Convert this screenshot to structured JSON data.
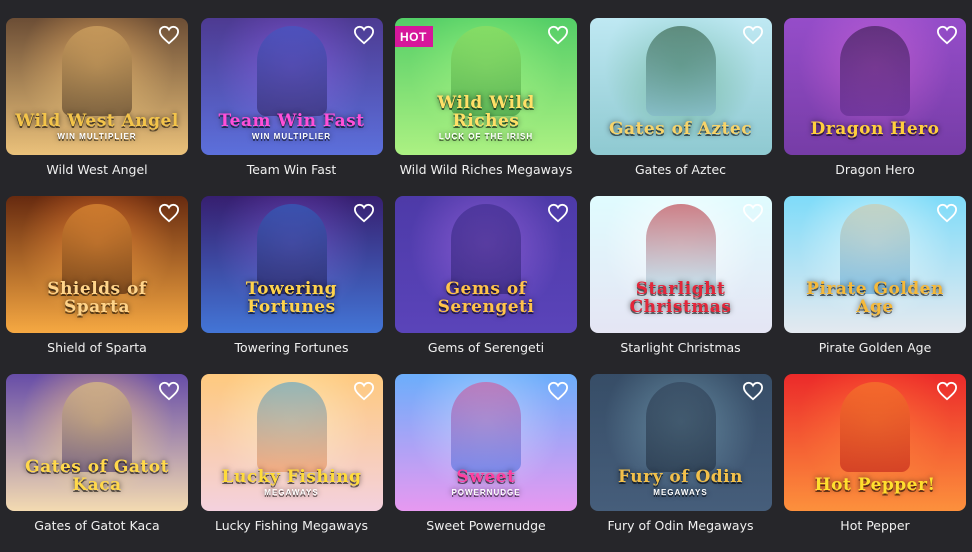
{
  "games": [
    {
      "title": "Wild West Angel",
      "logo": "Wild West Angel",
      "sub": "WIN MULTIPLIER",
      "hot": false,
      "bg": [
        "#3d2a1c",
        "#b3763a",
        "#e4b56a"
      ],
      "logo_color": "#f3c44a"
    },
    {
      "title": "Team Win Fast",
      "logo": "Team Win Fast",
      "sub": "WIN MULTIPLIER",
      "hot": false,
      "bg": [
        "#2a1f58",
        "#5a2fa0",
        "#3c5cc9"
      ],
      "logo_color": "#ff4fd8"
    },
    {
      "title": "Wild Wild Riches Megaways",
      "logo": "Wild Wild Riches",
      "sub": "LUCK OF THE IRISH",
      "hot": true,
      "bg": [
        "#2e8f3a",
        "#5bc24a",
        "#9adf5e"
      ],
      "logo_color": "#ffe067"
    },
    {
      "title": "Gates of Aztec",
      "logo": "Gates of Aztec",
      "sub": "",
      "hot": false,
      "bg": [
        "#7fb3c7",
        "#3f7b52",
        "#1f4a2c"
      ],
      "logo_color": "#f6d36a"
    },
    {
      "title": "Dragon Hero",
      "logo": "Dragon Hero",
      "sub": "",
      "hot": false,
      "bg": [
        "#5b2a8a",
        "#9a3ea6",
        "#2a163e"
      ],
      "logo_color": "#ffcf3c"
    },
    {
      "title": "Shield of Sparta",
      "logo": "Shields of Sparta",
      "sub": "",
      "hot": false,
      "bg": [
        "#3a1608",
        "#b8501c",
        "#f3a03c"
      ],
      "logo_color": "#ffd48a"
    },
    {
      "title": "Towering Fortunes",
      "logo": "Towering Fortunes",
      "sub": "",
      "hot": false,
      "bg": [
        "#1d1040",
        "#4d2a86",
        "#2b6cc8"
      ],
      "logo_color": "#ffd34c"
    },
    {
      "title": "Gems of Serengeti",
      "logo": "Gems of Serengeti",
      "sub": "",
      "hot": false,
      "bg": [
        "#2a1f6a",
        "#6a3fa8",
        "#3a2a88"
      ],
      "logo_color": "#ffc34a"
    },
    {
      "title": "Starlight Christmas",
      "logo": "Starlight Christmas",
      "sub": "",
      "hot": false,
      "bg": [
        "#a6e2f2",
        "#e8f7fb",
        "#b41b26"
      ],
      "logo_color": "#e3263a"
    },
    {
      "title": "Pirate Golden Age",
      "logo": "Pirate Golden Age",
      "sub": "",
      "hot": false,
      "bg": [
        "#4aa0d8",
        "#a8d7ef",
        "#d9c49a"
      ],
      "logo_color": "#f5b93a"
    },
    {
      "title": "Gates of Gatot Kaca",
      "logo": "Gates of Gatot Kaca",
      "sub": "",
      "hot": false,
      "bg": [
        "#3a2a6a",
        "#c28a3a",
        "#f0d37a"
      ],
      "logo_color": "#ffd84a"
    },
    {
      "title": "Lucky Fishing Megaways",
      "logo": "Lucky Fishing",
      "sub": "MEGAWAYS",
      "hot": false,
      "bg": [
        "#f08a4a",
        "#f7c07a",
        "#3e9bd0"
      ],
      "logo_color": "#ffdb3a"
    },
    {
      "title": "Sweet Powernudge",
      "logo": "Sweet",
      "sub": "POWERNUDGE",
      "hot": false,
      "bg": [
        "#3d6fe0",
        "#7aa8f4",
        "#e04a8a"
      ],
      "logo_color": "#ff3fa0"
    },
    {
      "title": "Fury of Odin Megaways",
      "logo": "Fury of Odin",
      "sub": "MEGAWAYS",
      "hot": false,
      "bg": [
        "#1d2a3a",
        "#4a6a7a",
        "#2e3e54"
      ],
      "logo_color": "#f2c04a"
    },
    {
      "title": "Hot Pepper",
      "logo": "Hot Pepper!",
      "sub": "",
      "hot": false,
      "bg": [
        "#b81616",
        "#e8401c",
        "#f7862a"
      ],
      "logo_color": "#ffdf2e"
    }
  ],
  "badge_hot": "HOT",
  "icons": {
    "favorite": "heart-outline-icon"
  }
}
